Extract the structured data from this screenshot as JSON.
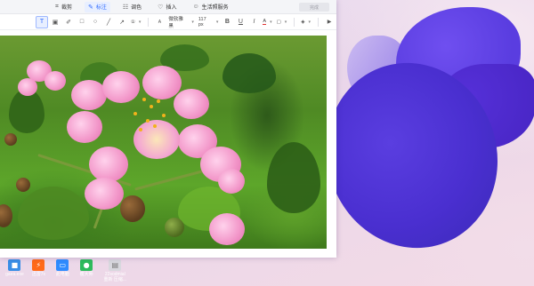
{
  "window": {
    "tabs": [
      {
        "label": "裁剪",
        "icon": "crop-icon"
      },
      {
        "label": "标注",
        "icon": "annotate-icon",
        "active": true
      },
      {
        "label": "调色",
        "icon": "adjust-icon"
      },
      {
        "label": "插入",
        "icon": "insert-icon"
      },
      {
        "label": "生活照服务",
        "icon": "portrait-service-icon"
      }
    ],
    "finish_label": "完成"
  },
  "toolbar": {
    "font_family": "微软雅黑",
    "font_size": "117 px",
    "bold": "B",
    "underline": "U",
    "italic": "I",
    "text_color_glyph": "A",
    "text_color": "#e03030"
  },
  "desktop_icons": [
    {
      "label": "gaea.exe",
      "color": "#3a8ee6",
      "icon": "exe-icon"
    },
    {
      "label": "迅雷7x",
      "color": "#ff6a1a",
      "icon": "thunder-icon"
    },
    {
      "label": "此电脑",
      "color": "#2f8cff",
      "icon": "computer-icon"
    },
    {
      "label": "瘦大师",
      "color": "#2dbb5c",
      "icon": "app-icon"
    },
    {
      "label": "22sodmial\n重新 压缩...",
      "color": "#d8d8de",
      "icon": "file-icon"
    }
  ]
}
